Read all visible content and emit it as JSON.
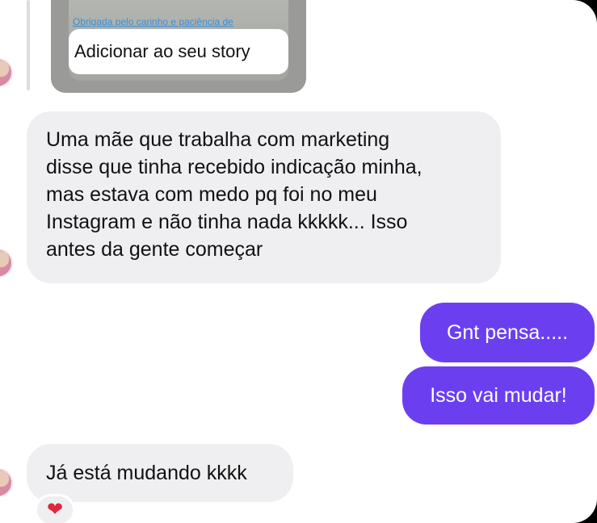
{
  "story_reply": {
    "caption": "Obrigada pelo carinho e paciência de",
    "button_label": "Adicionar ao seu story"
  },
  "messages": [
    {
      "direction": "incoming",
      "lines": [
        "Uma mãe que trabalha com marketing",
        "disse que tinha recebido indicação minha,",
        "mas estava com medo pq foi no meu",
        "Instagram e não tinha nada kkkkk... Isso",
        "antes da gente começar"
      ]
    },
    {
      "direction": "outgoing",
      "text": "Gnt pensa....."
    },
    {
      "direction": "outgoing",
      "text": "Isso vai mudar!"
    },
    {
      "direction": "incoming",
      "text": "Já está mudando kkkk",
      "reaction": "heart-icon"
    }
  ],
  "reaction_glyph": "❤",
  "colors": {
    "outgoing_bubble": "#6b3ff0",
    "incoming_bubble": "#efeff1",
    "reaction_heart": "#e0283c"
  }
}
